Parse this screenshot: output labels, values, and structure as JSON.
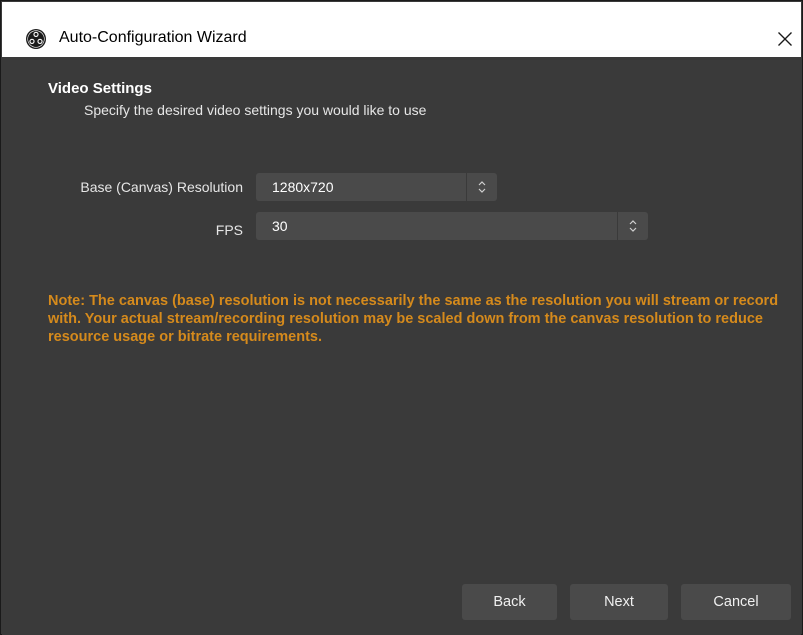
{
  "window": {
    "title": "Auto-Configuration Wizard",
    "close_glyph": "✕"
  },
  "section": {
    "title": "Video Settings",
    "subtitle": "Specify the desired video settings you would like to use"
  },
  "form": {
    "resolution": {
      "label": "Base (Canvas) Resolution",
      "value": "1280x720"
    },
    "fps": {
      "label": "FPS",
      "value": "30"
    }
  },
  "note": "Note: The canvas (base) resolution is not necessarily the same as the resolution you will stream or record with. Your actual stream/recording resolution may be scaled down from the canvas resolution to reduce resource usage or bitrate requirements.",
  "buttons": {
    "back": "Back",
    "next": "Next",
    "cancel": "Cancel"
  },
  "colors": {
    "background": "#3a3a3a",
    "control": "#4a4a4a",
    "note": "#d58a1c"
  },
  "icons": {
    "app": "obs-logo-icon",
    "close": "close-icon",
    "spinner": "up-down-chevron-icon"
  }
}
